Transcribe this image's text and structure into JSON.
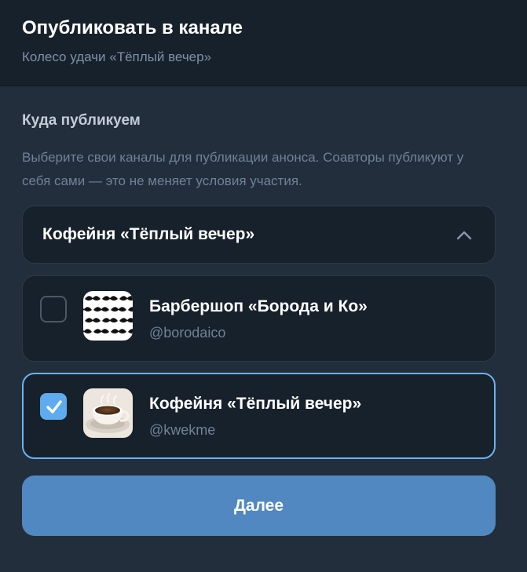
{
  "header": {
    "title": "Опубликовать в канале",
    "subtitle": "Колесо удачи «Тёплый вечер»"
  },
  "section": {
    "title": "Куда публикуем",
    "description": "Выберите свои каналы для публикации анонса. Соавторы публикуют у себя сами — это не меняет условия участия."
  },
  "dropdown": {
    "selected_label": "Кофейня «Тёплый вечер»",
    "icon": "chevron-up-icon",
    "expanded": true
  },
  "channels": [
    {
      "name": "Барбершоп «Борода и Ко»",
      "handle": "@borodaico",
      "checked": false,
      "avatar": "mustache-pattern-avatar"
    },
    {
      "name": "Кофейня «Тёплый вечер»",
      "handle": "@kwekme",
      "checked": true,
      "avatar": "coffee-cup-avatar"
    }
  ],
  "actions": {
    "next_label": "Далее"
  },
  "colors": {
    "background": "#232e3c",
    "header_background": "#17212b",
    "card_background": "#17212b",
    "accent": "#6ab2f2",
    "checkbox_checked": "#5eacef",
    "button": "#5288c1",
    "muted_text": "#6f8296"
  }
}
